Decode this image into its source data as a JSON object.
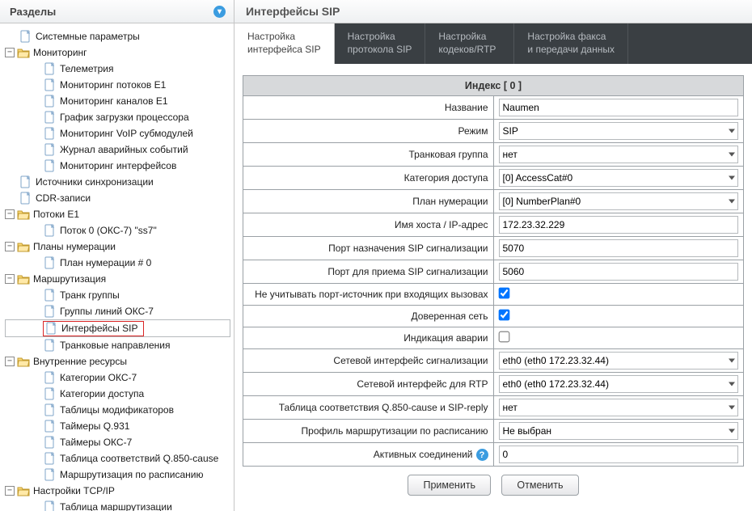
{
  "sidebar": {
    "title": "Разделы",
    "items": {
      "sys_params": "Системные параметры",
      "monitoring": "Мониторинг",
      "telemetry": "Телеметрия",
      "mon_e1_flows": "Мониторинг потоков E1",
      "mon_e1_chan": "Мониторинг каналов E1",
      "cpu_graph": "График загрузки процессора",
      "mon_voip": "Мониторинг VoIP субмодулей",
      "alarm_log": "Журнал аварийных событий",
      "mon_if": "Мониторинг интерфейсов",
      "sync_src": "Источники синхронизации",
      "cdr": "CDR-записи",
      "e1_flows": "Потоки E1",
      "flow0": "Поток 0 (ОКС-7) \"ss7\"",
      "num_plans": "Планы нумерации",
      "num_plan0": "План нумерации # 0",
      "routing": "Маршрутизация",
      "trunk_groups": "Транк группы",
      "oks7_groups": "Группы линий ОКС-7",
      "sip_if": "Интерфейсы SIP",
      "trunk_dirs": "Транковые направления",
      "internal": "Внутренние ресурсы",
      "oks7_cat": "Категории ОКС-7",
      "access_cat": "Категории доступа",
      "mod_tables": "Таблицы модификаторов",
      "q931_timers": "Таймеры Q.931",
      "oks7_timers": "Таймеры ОКС-7",
      "q850_table": "Таблица соответствий Q.850-cause",
      "sched_routing": "Маршрутизация по расписанию",
      "tcpip": "Настройки TCP/IP",
      "route_table": "Таблица маршрутизации"
    }
  },
  "page": {
    "title": "Интерфейсы SIP",
    "tabs": {
      "t1a": "Настройка",
      "t1b": "интерфейса SIP",
      "t2a": "Настройка",
      "t2b": "протокола SIP",
      "t3a": "Настройка",
      "t3b": "кодеков/RTP",
      "t4a": "Настройка факса",
      "t4b": "и передачи данных"
    }
  },
  "form": {
    "group_header": "Индекс [ 0 ]",
    "labels": {
      "name": "Название",
      "mode": "Режим",
      "trunk_group": "Транковая группа",
      "access_cat": "Категория доступа",
      "num_plan": "План нумерации",
      "host": "Имя хоста / IP-адрес",
      "dst_port": "Порт назначения SIP сигнализации",
      "lsn_port": "Порт для приема SIP сигнализации",
      "ignore_src": "Не учитывать порт-источник при входящих вызовах",
      "trusted": "Доверенная сеть",
      "alarm_ind": "Индикация аварии",
      "sig_if": "Сетевой интерфейс сигнализации",
      "rtp_if": "Сетевой интерфейс для RTP",
      "q850_map": "Таблица соответствия Q.850-cause и SIP-reply",
      "sched_prof": "Профиль маршрутизации по расписанию",
      "active_conn": "Активных соединений"
    },
    "values": {
      "name": "Naumen",
      "mode": "SIP",
      "trunk_group": "нет",
      "access_cat": "[0] AccessCat#0",
      "num_plan": "[0] NumberPlan#0",
      "host": "172.23.32.229",
      "dst_port": "5070",
      "lsn_port": "5060",
      "ignore_src": true,
      "trusted": true,
      "alarm_ind": false,
      "sig_if": "eth0 (eth0 172.23.32.44)",
      "rtp_if": "eth0 (eth0 172.23.32.44)",
      "q850_map": "нет",
      "sched_prof": "Не выбран",
      "active_conn": "0"
    }
  },
  "buttons": {
    "apply": "Применить",
    "cancel": "Отменить"
  }
}
